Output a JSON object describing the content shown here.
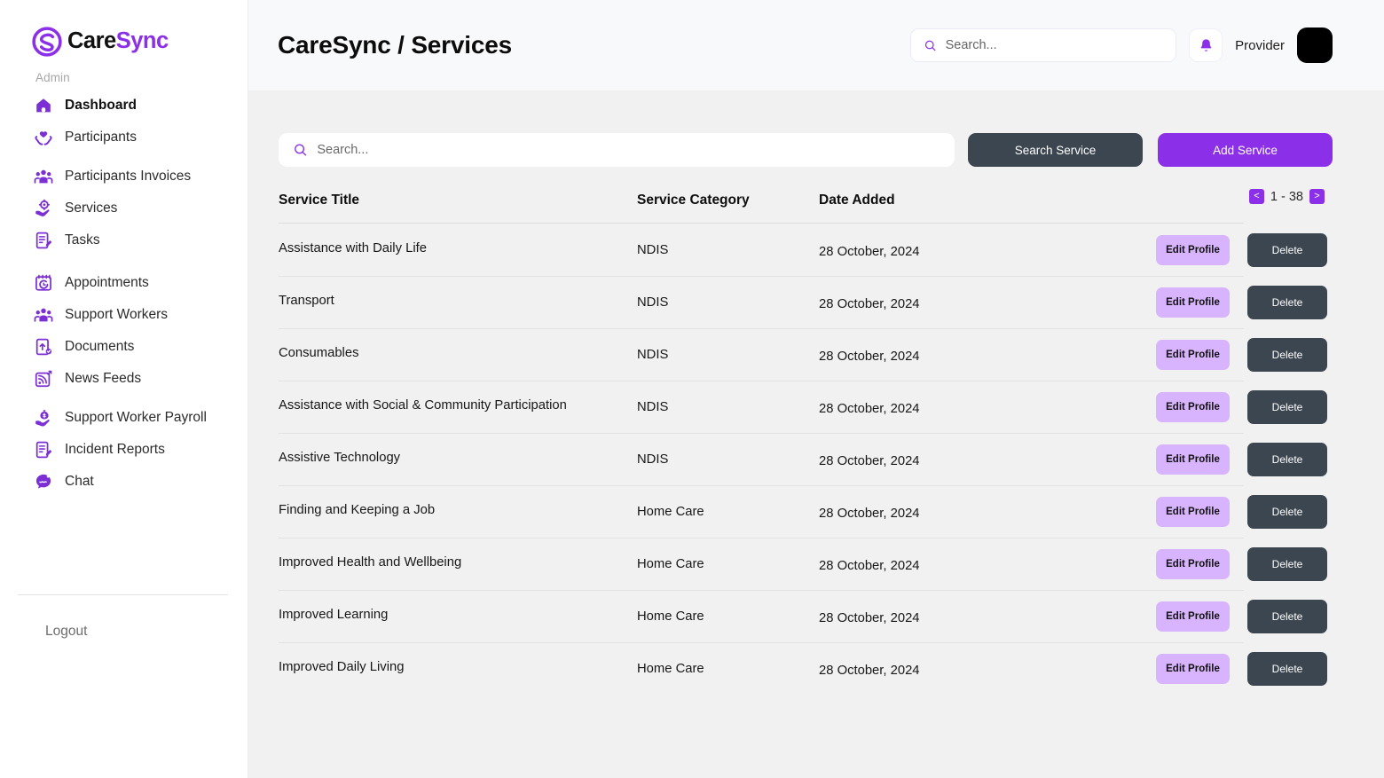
{
  "brand": {
    "name_part1": "Care",
    "name_part2": "Sync",
    "logo_icon": "caresync-swirl-logo",
    "accent_purple": "#8b2fe8",
    "dark_slate": "#3c4650",
    "light_purple": "#d8b4fe"
  },
  "sidebar": {
    "section_label": "Admin",
    "items": [
      {
        "label": "Dashboard",
        "icon": "home-icon",
        "active": true
      },
      {
        "label": "Participants",
        "icon": "hands-heart-icon",
        "active": false
      },
      {
        "label": "Participants Invoices",
        "icon": "people-group-icon",
        "active": false
      },
      {
        "label": "Services",
        "icon": "hand-gear-icon",
        "active": false
      },
      {
        "label": "Tasks",
        "icon": "document-pen-icon",
        "active": false
      },
      {
        "label": "Appointments",
        "icon": "calendar-clock-icon",
        "active": false
      },
      {
        "label": "Support Workers",
        "icon": "people-group-icon",
        "active": false
      },
      {
        "label": "Documents",
        "icon": "document-upload-icon",
        "active": false
      },
      {
        "label": "News Feeds",
        "icon": "rss-feed-icon",
        "active": false
      },
      {
        "label": "Support Worker Payroll",
        "icon": "hand-money-icon",
        "active": false
      },
      {
        "label": "Incident Reports",
        "icon": "document-pen-icon",
        "active": false
      },
      {
        "label": "Chat",
        "icon": "chat-bubble-icon",
        "active": false
      }
    ],
    "logout": {
      "label": "Logout",
      "icon": "logout-icon"
    }
  },
  "topbar": {
    "title": "CareSync / Services",
    "search": {
      "placeholder": "Search...",
      "value": "",
      "icon": "search-icon"
    },
    "bell_icon": "bell-icon",
    "provider_label": "Provider",
    "avatar_icon": "avatar"
  },
  "toolbar": {
    "search": {
      "placeholder": "Search...",
      "value": "",
      "icon": "search-icon"
    },
    "search_service_label": "Search Service",
    "add_service_label": "Add Service"
  },
  "table": {
    "columns": [
      "Service Title",
      "Service Category",
      "Date Added"
    ],
    "pagination": {
      "range": "1 - 38",
      "prev_icon": "chevron-left-icon",
      "next_icon": "chevron-right-icon",
      "prev_label": "<",
      "next_label": ">"
    },
    "actions": {
      "edit_label": "Edit Profile",
      "delete_label": "Delete"
    },
    "rows": [
      {
        "title": "Assistance with Daily Life",
        "category": "NDIS",
        "date": "28 October, 2024"
      },
      {
        "title": "Transport",
        "category": "NDIS",
        "date": "28 October, 2024"
      },
      {
        "title": "Consumables",
        "category": "NDIS",
        "date": "28 October, 2024"
      },
      {
        "title": "Assistance with Social & Community Participation",
        "category": "NDIS",
        "date": "28 October, 2024"
      },
      {
        "title": "Assistive Technology",
        "category": "NDIS",
        "date": "28 October, 2024"
      },
      {
        "title": "Finding and Keeping a Job",
        "category": "Home Care",
        "date": "28 October, 2024"
      },
      {
        "title": "Improved Health and Wellbeing",
        "category": "Home Care",
        "date": "28 October, 2024"
      },
      {
        "title": "Improved Learning",
        "category": "Home Care",
        "date": "28 October, 2024"
      },
      {
        "title": "Improved Daily Living",
        "category": "Home Care",
        "date": "28 October, 2024"
      }
    ]
  }
}
